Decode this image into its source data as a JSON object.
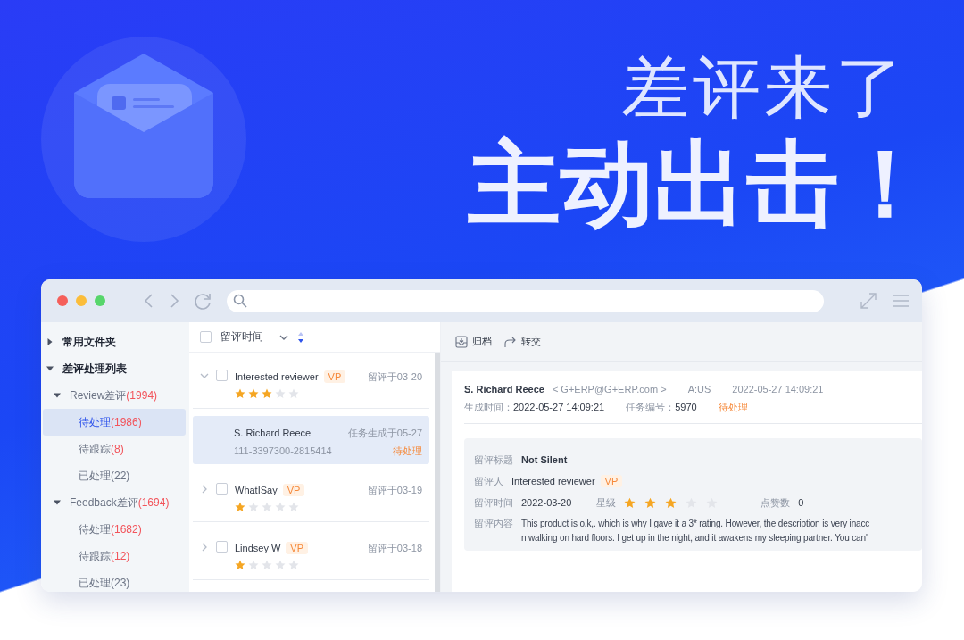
{
  "hero": {
    "headline": "差评来了",
    "slogan": "主动出击！"
  },
  "sidebar": {
    "items": [
      {
        "label": "常用文件夹",
        "expanded": false
      },
      {
        "label": "差评处理列表",
        "expanded": true,
        "children": [
          {
            "label": "Review差评",
            "count": "(1994)",
            "count_alert": true,
            "expanded": true,
            "children": [
              {
                "label": "待处理",
                "count": "(1986)",
                "count_alert": true,
                "selected": true
              },
              {
                "label": "待跟踪",
                "count": "(8)",
                "count_alert": true,
                "selected": false
              },
              {
                "label": "已处理",
                "count": "(22)",
                "count_alert": false,
                "selected": false
              }
            ]
          },
          {
            "label": "Feedback差评",
            "count": "(1694)",
            "count_alert": true,
            "expanded": true,
            "children": [
              {
                "label": "待处理",
                "count": "(1682)",
                "count_alert": true,
                "selected": false
              },
              {
                "label": "待跟踪",
                "count": "(12)",
                "count_alert": true,
                "selected": false
              },
              {
                "label": "已处理",
                "count": "(23)",
                "count_alert": false,
                "selected": false
              }
            ]
          }
        ]
      }
    ]
  },
  "list": {
    "header": {
      "label": "留评时间",
      "checked": false
    },
    "rows": [
      {
        "kind": "review",
        "expanded": true,
        "checked": false,
        "name": "Interested reviewer",
        "badge": "VP",
        "stars": 3,
        "date": "留评于03-20",
        "selected": false
      },
      {
        "kind": "task",
        "name": "S. Richard Reece",
        "order": "111-3397300-2815414",
        "date": "任务生成于05-27",
        "status": "待处理",
        "selected": true
      },
      {
        "kind": "review",
        "expanded": false,
        "checked": false,
        "name": "WhatISay",
        "badge": "VP",
        "stars": 1,
        "date": "留评于03-19",
        "selected": false
      },
      {
        "kind": "review",
        "expanded": false,
        "checked": false,
        "name": "Lindsey W",
        "badge": "VP",
        "stars": 1,
        "date": "留评于03-18",
        "selected": false
      }
    ]
  },
  "detail": {
    "toolbar": [
      {
        "kind": "archive",
        "label": "归档"
      },
      {
        "kind": "forward",
        "label": "转交"
      }
    ],
    "header": {
      "name": "S. Richard Reece",
      "email": "< G+ERP@G+ERP.com >",
      "site": "A:US",
      "time": "2022-05-27 14:09:21",
      "created_label": "生成时间：",
      "created": "2022-05-27 14:09:21",
      "task_label": "任务编号：",
      "task_no": "5970",
      "status": "待处理"
    },
    "review": {
      "title_label": "留评标题",
      "title": "Not Silent",
      "reviewer_label": "留评人",
      "reviewer": "Interested reviewer",
      "badge": "VP",
      "time_label": "留评时间",
      "time": "2022-03-20",
      "stars_label": "星级",
      "stars": 3,
      "likes_label": "点赞数",
      "likes": "0",
      "content_label": "留评内容",
      "content_lines": [
        "This product is o.k,. which is why I gave it a 3* rating. However, the description is very inacc",
        "n walking on hard floors. I get up in the night, and it awakens my sleeping partner. You can'"
      ]
    }
  }
}
